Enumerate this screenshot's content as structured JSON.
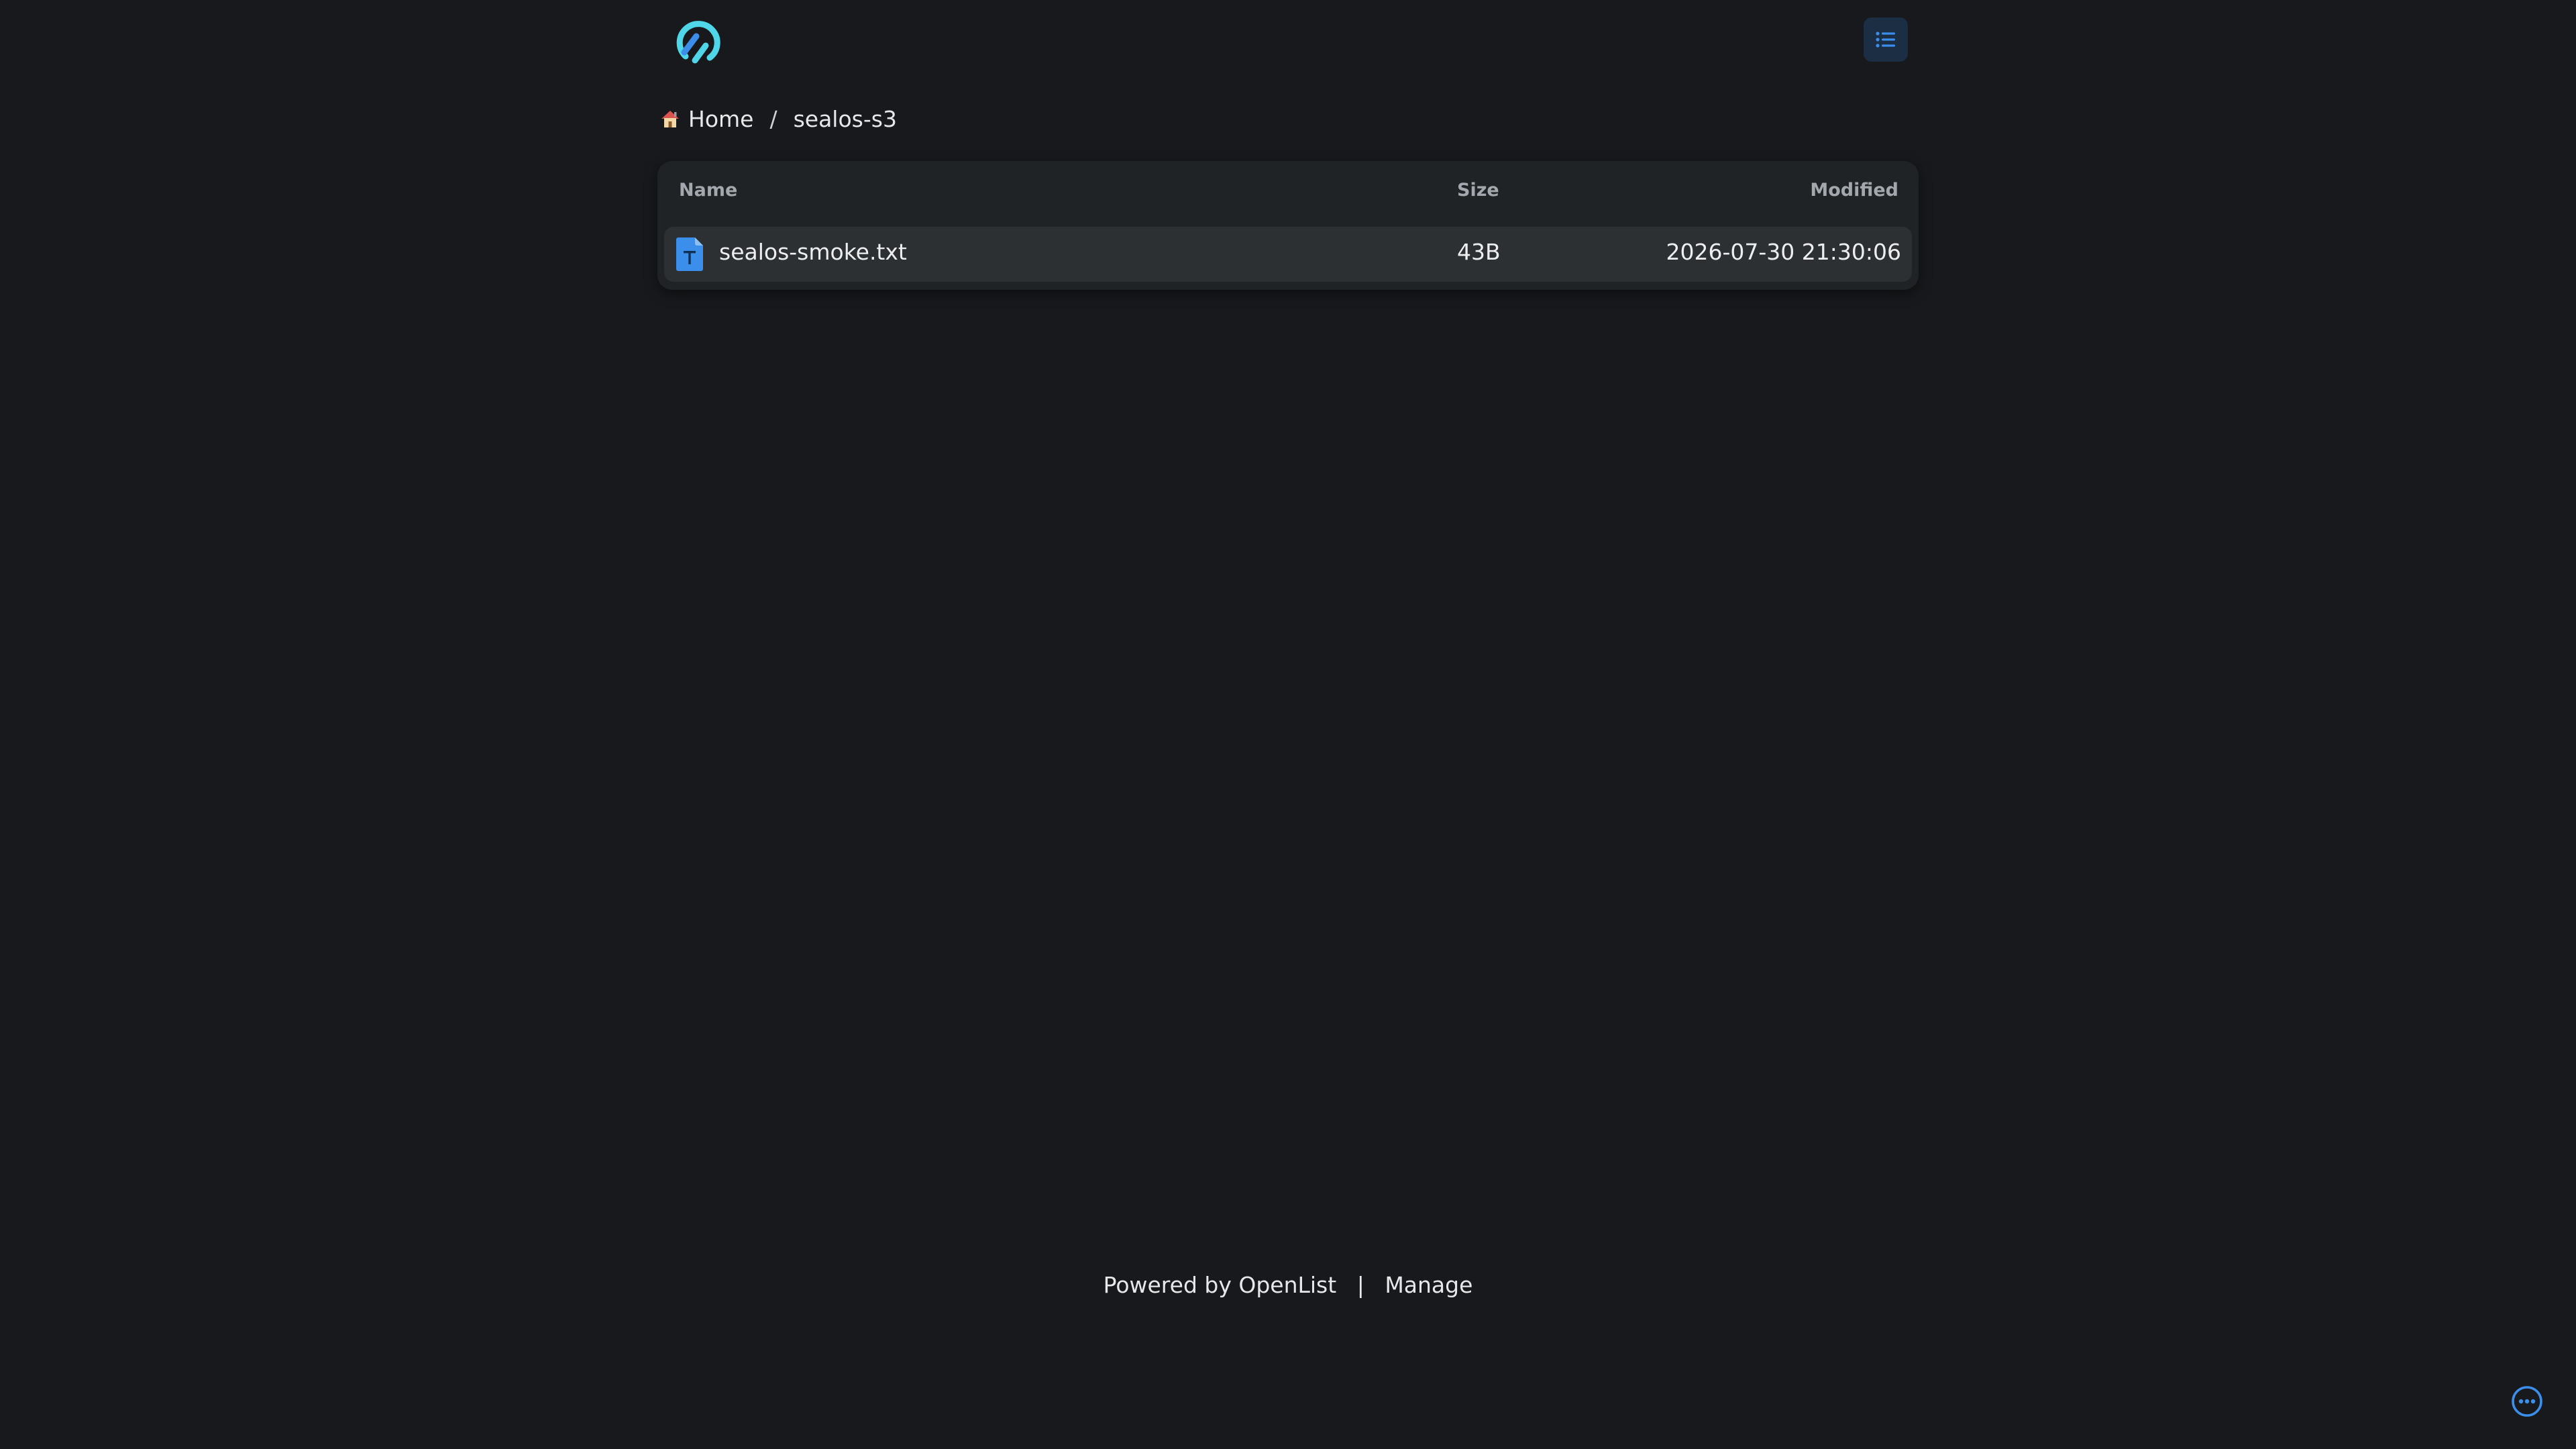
{
  "header": {
    "logo_icon": "openlist-logo-icon",
    "layout_toggle_icon": "list-icon"
  },
  "breadcrumb": {
    "home_icon": "house-icon",
    "home_label": "Home",
    "separator": "/",
    "current": "sealos-s3"
  },
  "file_list": {
    "columns": {
      "name": "Name",
      "size": "Size",
      "modified": "Modified"
    },
    "rows": [
      {
        "icon": "text-file-icon",
        "name": "sealos-smoke.txt",
        "size": "43B",
        "modified": "2026-07-30 21:30:06"
      }
    ]
  },
  "footer": {
    "powered_by": "Powered by OpenList",
    "separator": "|",
    "manage": "Manage"
  },
  "colors": {
    "background": "#17191c",
    "panel": "#202326",
    "row_highlight": "#2d3033",
    "accent": "#3b8eea",
    "logo_cyan": "#4fd6e8"
  }
}
